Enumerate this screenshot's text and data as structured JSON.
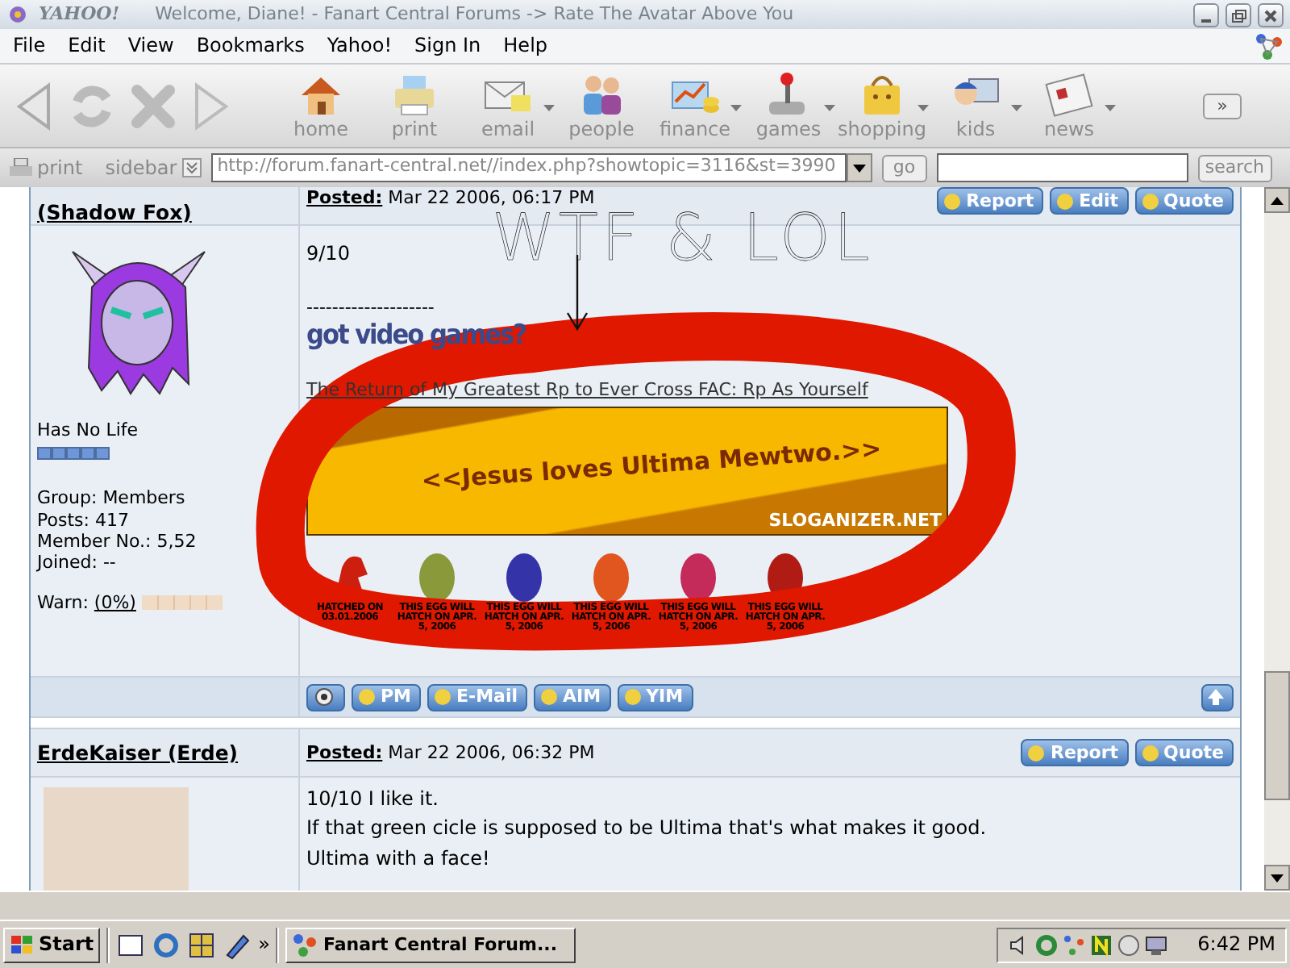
{
  "window": {
    "brand": "YAHOO!",
    "title": "Welcome, Diane! - Fanart Central Forums -> Rate The Avatar Above You"
  },
  "menu": [
    "File",
    "Edit",
    "View",
    "Bookmarks",
    "Yahoo!",
    "Sign In",
    "Help"
  ],
  "toolbar": [
    {
      "label": "home",
      "dropdown": false
    },
    {
      "label": "print",
      "dropdown": false
    },
    {
      "label": "email",
      "dropdown": true
    },
    {
      "label": "people",
      "dropdown": false
    },
    {
      "label": "finance",
      "dropdown": true
    },
    {
      "label": "games",
      "dropdown": true
    },
    {
      "label": "shopping",
      "dropdown": true
    },
    {
      "label": "kids",
      "dropdown": true
    },
    {
      "label": "news",
      "dropdown": true
    }
  ],
  "more_button": "»",
  "address_bar": {
    "print": "print",
    "sidebar": "sidebar",
    "url": "http://forum.fanart-central.net//index.php?showtopic=3116&st=3990",
    "go": "go",
    "search": "search"
  },
  "posts": [
    {
      "author": "(Shadow Fox)",
      "posted_label": "Posted:",
      "posted": "Mar 22 2006, 06:17 PM",
      "actions": [
        "Report",
        "Edit",
        "Quote"
      ],
      "rank": "Has No Life",
      "stars": 5,
      "details": [
        "Group: Members",
        "Posts: 417",
        "Member No.: 5,52",
        "Joined: --"
      ],
      "warn": {
        "label": "Warn:",
        "value": "(0%)"
      },
      "body": [
        "9/10"
      ],
      "signature": {
        "rule": "--------------------",
        "headline": "got video games?",
        "link": "The Return of My Greatest Rp to Ever Cross FAC: Rp As Yourself",
        "banner": {
          "text": "<<Jesus loves Ultima Mewtwo.>>",
          "brand": "SLOGANIZER.NET"
        },
        "eggs": [
          {
            "kind": "creature",
            "color": "#cc1f10",
            "label": "HATCHED ON 03.01.2006"
          },
          {
            "kind": "egg",
            "color": "#8a9a3a",
            "label": "THIS EGG WILL HATCH ON APR. 5, 2006"
          },
          {
            "kind": "egg",
            "color": "#3434a8",
            "label": "THIS EGG WILL HATCH ON APR. 5, 2006"
          },
          {
            "kind": "egg",
            "color": "#e0561e",
            "label": "THIS EGG WILL HATCH ON APR. 5, 2006"
          },
          {
            "kind": "egg",
            "color": "#c42a5a",
            "label": "THIS EGG WILL HATCH ON APR. 5, 2006"
          },
          {
            "kind": "egg",
            "color": "#b01c14",
            "label": "THIS EGG WILL HATCH ON APR. 5, 2006"
          }
        ]
      },
      "contacts": [
        "PM",
        "E-Mail",
        "AIM",
        "YIM"
      ]
    },
    {
      "author": "ErdeKaiser (Erde)",
      "posted_label": "Posted:",
      "posted": "Mar 22 2006, 06:32 PM",
      "actions": [
        "Report",
        "Quote"
      ],
      "body": [
        "10/10 I like it.",
        "If that green cicle is supposed to be Ultima that's what makes it good.",
        "Ultima with a face!"
      ]
    }
  ],
  "annotation": {
    "text": "WTF & LOL"
  },
  "taskbar": {
    "start": "Start",
    "chevron": "»",
    "task": "Fanart Central Forum...",
    "clock": "6:42 PM"
  }
}
